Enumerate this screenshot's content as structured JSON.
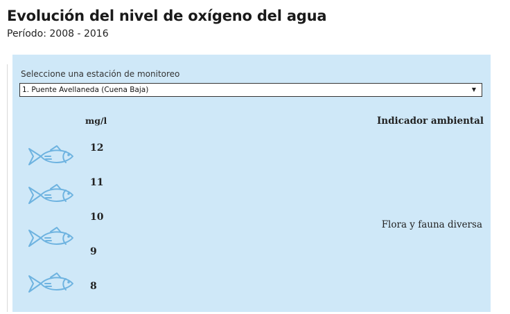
{
  "header": {
    "title": "Evolución del nivel de oxígeno del agua",
    "subtitle": "Período: 2008 - 2016"
  },
  "widget": {
    "background_color": "#cfe8f8",
    "station_label": "Seleccione una estación de monitoreo",
    "station_selected": "1. Puente Avellaneda (Cuena Baja)",
    "dropdown_arrow": "▼",
    "unit_label": "mg/l",
    "indicator_header": "Indicador ambiental",
    "indicator_value": "Flora y fauna diversa",
    "levels": [
      "12",
      "11",
      "10",
      "9",
      "8"
    ],
    "fish_icon_count": 4,
    "fish_icon": "fish-icon",
    "fish_color": "#6eb3e0"
  }
}
